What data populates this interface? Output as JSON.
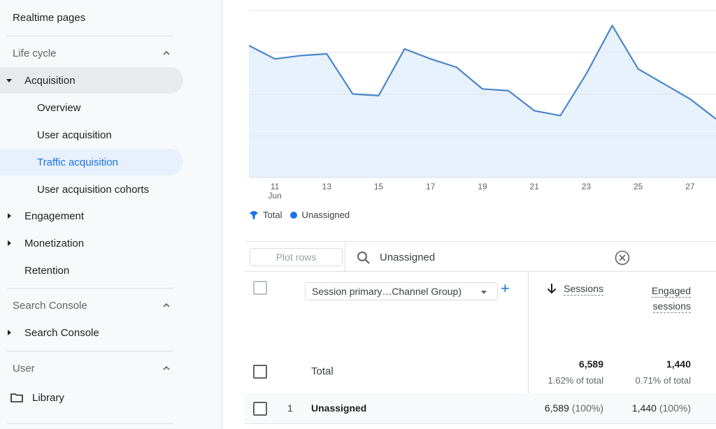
{
  "sidebar": {
    "realtime_pages": "Realtime pages",
    "life_cycle": "Life cycle",
    "acquisition": "Acquisition",
    "overview": "Overview",
    "user_acquisition": "User acquisition",
    "traffic_acquisition": "Traffic acquisition",
    "user_acquisition_cohorts": "User acquisition cohorts",
    "engagement": "Engagement",
    "monetization": "Monetization",
    "retention": "Retention",
    "search_console_section": "Search Console",
    "search_console_item": "Search Console",
    "user_section": "User",
    "library": "Library"
  },
  "chart_data": {
    "type": "area",
    "x_tick_labels": [
      "11",
      "13",
      "15",
      "17",
      "19",
      "21",
      "23",
      "25",
      "27"
    ],
    "x_sub_label": "Jun",
    "x": [
      10,
      11,
      12,
      13,
      14,
      15,
      16,
      17,
      18,
      19,
      20,
      21,
      22,
      23,
      24,
      25,
      26,
      27,
      28
    ],
    "series": [
      {
        "name": "Unassigned",
        "values": [
          0.79,
          0.71,
          0.73,
          0.74,
          0.5,
          0.49,
          0.77,
          0.71,
          0.66,
          0.53,
          0.52,
          0.4,
          0.37,
          0.62,
          0.91,
          0.65,
          0.56,
          0.47,
          0.35
        ]
      }
    ],
    "grid": true,
    "legend": [
      "Total",
      "Unassigned"
    ],
    "color": "#4a86c8"
  },
  "legend": {
    "total": "Total",
    "unassigned": "Unassigned"
  },
  "table": {
    "plot_rows": "Plot rows",
    "search_value": "Unassigned",
    "dimension": "Session primary…Channel Group)",
    "add_symbol": "+",
    "col_sessions": "Sessions",
    "col_engaged_1": "Engaged",
    "col_engaged_2": "sessions",
    "total_label": "Total",
    "total_sessions": "6,589",
    "total_sessions_pct": "1.62% of total",
    "total_engaged": "1,440",
    "total_engaged_pct": "0.71% of total",
    "rows": [
      {
        "index": "1",
        "dimension": "Unassigned",
        "sessions": "6,589",
        "sessions_pct": "(100%)",
        "engaged": "1,440",
        "engaged_pct": "(100%)"
      }
    ]
  }
}
